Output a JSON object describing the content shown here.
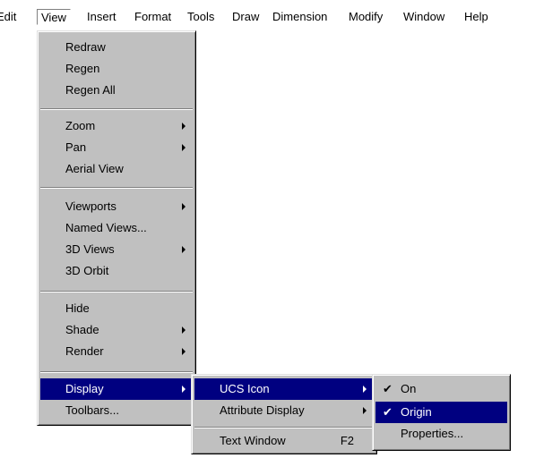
{
  "menubar": {
    "items": [
      {
        "label": "Edit"
      },
      {
        "label": "View"
      },
      {
        "label": "Insert"
      },
      {
        "label": "Format"
      },
      {
        "label": "Tools"
      },
      {
        "label": "Draw"
      },
      {
        "label": "Dimension"
      },
      {
        "label": "Modify"
      },
      {
        "label": "Window"
      },
      {
        "label": "Help"
      }
    ]
  },
  "view_menu": {
    "items": [
      {
        "label": "Redraw"
      },
      {
        "label": "Regen"
      },
      {
        "label": "Regen All"
      },
      {
        "label": "Zoom"
      },
      {
        "label": "Pan"
      },
      {
        "label": "Aerial View"
      },
      {
        "label": "Viewports"
      },
      {
        "label": "Named Views..."
      },
      {
        "label": "3D Views"
      },
      {
        "label": "3D Orbit"
      },
      {
        "label": "Hide"
      },
      {
        "label": "Shade"
      },
      {
        "label": "Render"
      },
      {
        "label": "Display"
      },
      {
        "label": "Toolbars..."
      }
    ]
  },
  "display_menu": {
    "items": [
      {
        "label": "UCS Icon"
      },
      {
        "label": "Attribute Display"
      },
      {
        "label": "Text Window",
        "shortcut": "F2"
      }
    ]
  },
  "ucs_menu": {
    "items": [
      {
        "label": "On",
        "checked": "✔"
      },
      {
        "label": "Origin",
        "checked": "✔"
      },
      {
        "label": "Properties..."
      }
    ]
  },
  "colors": {
    "menu_bg": "#c0c0c0",
    "highlight": "#000080"
  }
}
